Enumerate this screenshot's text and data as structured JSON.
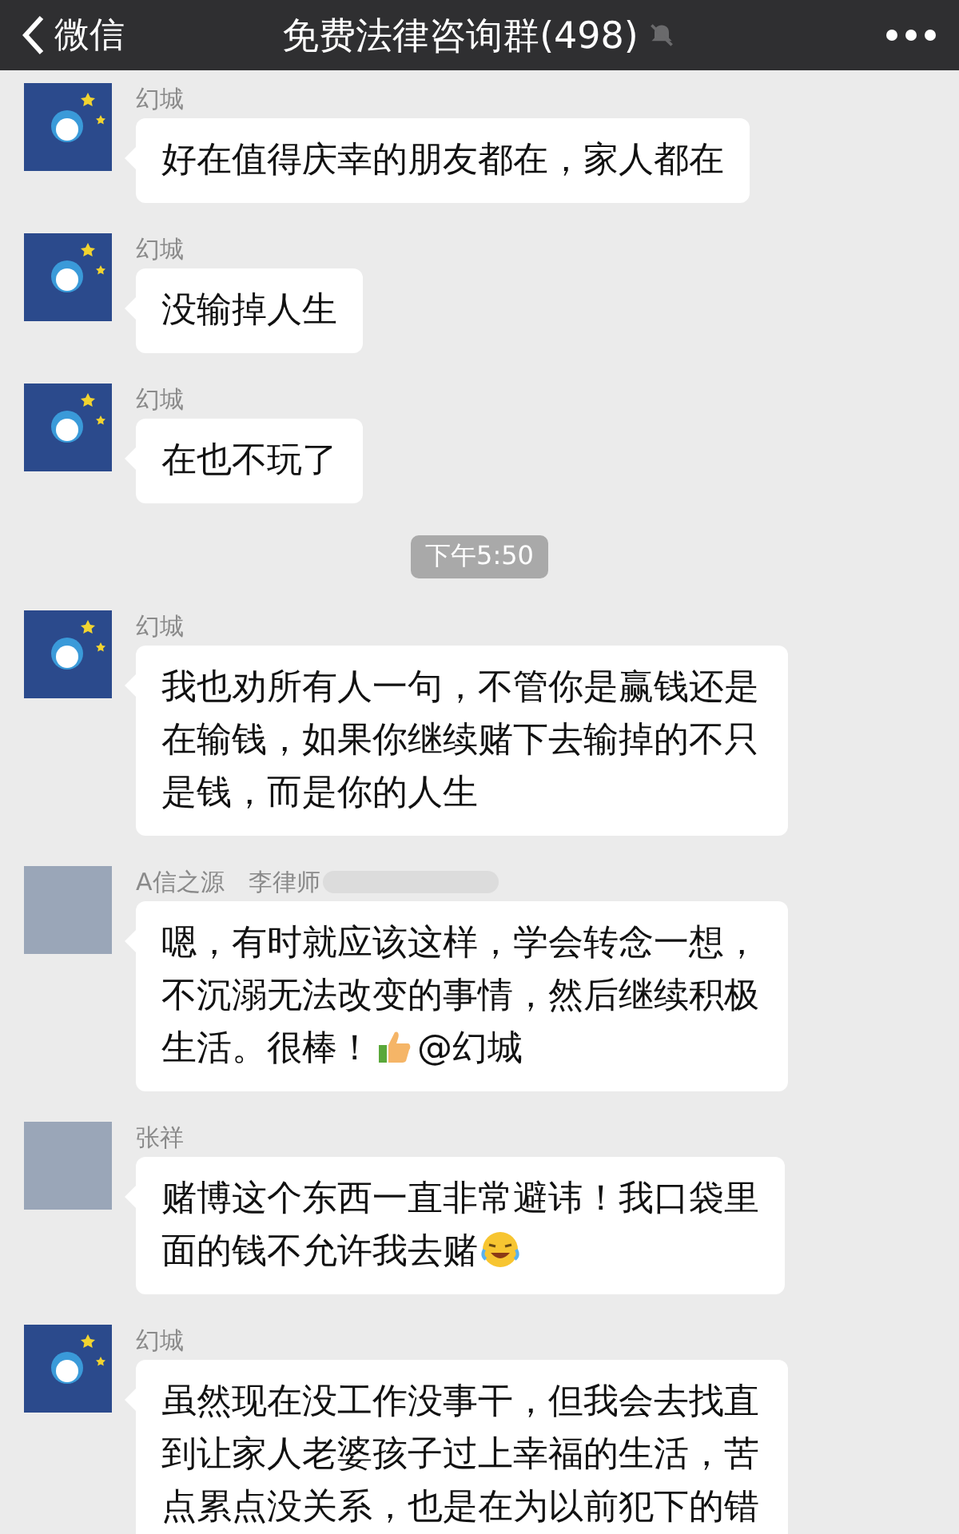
{
  "header": {
    "back_label": "微信",
    "title": "免费法律咨询群(498)",
    "muted": true
  },
  "messages": [
    {
      "kind": "message",
      "sender": "幻城",
      "avatar": {
        "kind": "cartoon"
      },
      "sender_redacted": false,
      "parts": [
        {
          "kind": "text",
          "text": "好在值得庆幸的朋友都在，家人都在"
        }
      ]
    },
    {
      "kind": "message",
      "sender": "幻城",
      "avatar": {
        "kind": "cartoon"
      },
      "sender_redacted": false,
      "parts": [
        {
          "kind": "text",
          "text": "没输掉人生"
        }
      ]
    },
    {
      "kind": "message",
      "sender": "幻城",
      "avatar": {
        "kind": "cartoon"
      },
      "sender_redacted": false,
      "parts": [
        {
          "kind": "text",
          "text": "在也不玩了"
        }
      ]
    },
    {
      "kind": "time",
      "text": "下午5:50"
    },
    {
      "kind": "message",
      "sender": "幻城",
      "avatar": {
        "kind": "cartoon"
      },
      "sender_redacted": false,
      "parts": [
        {
          "kind": "text",
          "text": "我也劝所有人一句，不管你是赢钱还是在输钱，如果你继续赌下去输掉的不只是钱，而是你的人生"
        }
      ]
    },
    {
      "kind": "message",
      "sender": "A信之源　李律师",
      "avatar": {
        "kind": "photo"
      },
      "sender_redacted": true,
      "parts": [
        {
          "kind": "line",
          "text": "嗯，有时就应该这样，学会转念一想，不沉溺无法改变的事情，然后继续积极"
        },
        {
          "kind": "text",
          "text": "生活。很棒！"
        },
        {
          "kind": "thumbs"
        },
        {
          "kind": "text",
          "text": "@幻城"
        }
      ]
    },
    {
      "kind": "message",
      "sender": "张祥",
      "avatar": {
        "kind": "photo"
      },
      "sender_redacted": false,
      "parts": [
        {
          "kind": "line",
          "text": "赌博这个东西一直非常避讳！我口袋里"
        },
        {
          "kind": "text",
          "text": "面的钱不允许我去赌"
        },
        {
          "kind": "laugh"
        }
      ]
    },
    {
      "kind": "message",
      "sender": "幻城",
      "avatar": {
        "kind": "cartoon"
      },
      "sender_redacted": false,
      "parts": [
        {
          "kind": "text",
          "text": "虽然现在没工作没事干，但我会去找直到让家人老婆孩子过上幸福的生活，苦点累点没关系，也是在为以前犯下的错"
        }
      ]
    }
  ]
}
